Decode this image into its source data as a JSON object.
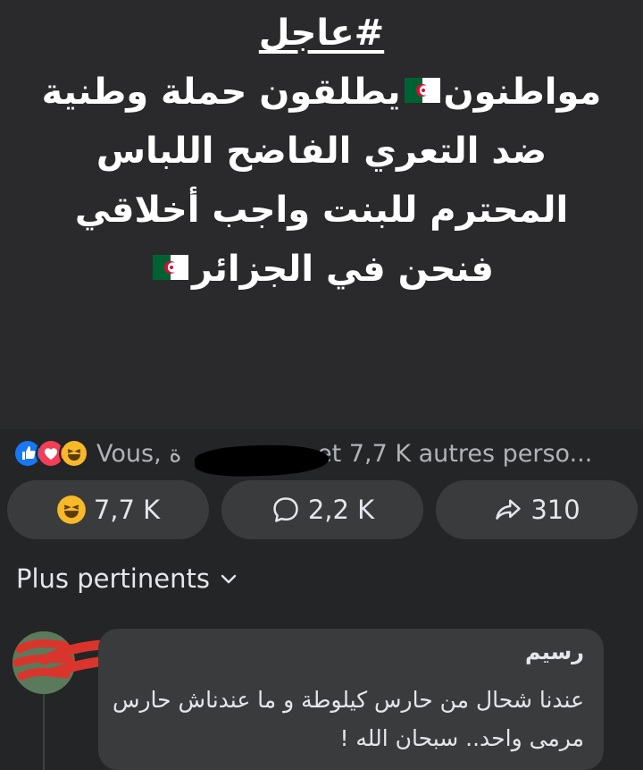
{
  "post": {
    "hashtag": "#عاجل",
    "line1": "مواطنون",
    "line1b": "يطلقون حملة وطنية",
    "line2": "ضد التعري الفاضح اللباس",
    "line3": "المحترم للبنت واجب أخلاقي",
    "line4": "فنحن في الجزائر",
    "flag_colors": {
      "green": "#006233",
      "white": "#ffffff",
      "red": "#d21034"
    }
  },
  "reactions": {
    "icons": [
      "like-icon",
      "love-icon",
      "haha-icon"
    ],
    "text_prefix": "Vous, ر",
    "text_suffix": "ة et 7,7 K autres perso..."
  },
  "actions": {
    "react_count": "7,7 K",
    "comment_count": "2,2 K",
    "share_count": "310"
  },
  "comments": {
    "sort_label": "Plus pertinents",
    "items": [
      {
        "author": "رسيم",
        "text": "عندنا شحال من حارس كيلوطة و ما عندناش حارس مرمى واحد.. سبحان الله !"
      }
    ]
  },
  "colors": {
    "background": "#242526",
    "post_background": "#2a2a2c",
    "button_background": "#3a3b3c",
    "like_blue": "#1877f2",
    "love_red": "#f33e58",
    "haha_yellow": "#f7b928"
  }
}
